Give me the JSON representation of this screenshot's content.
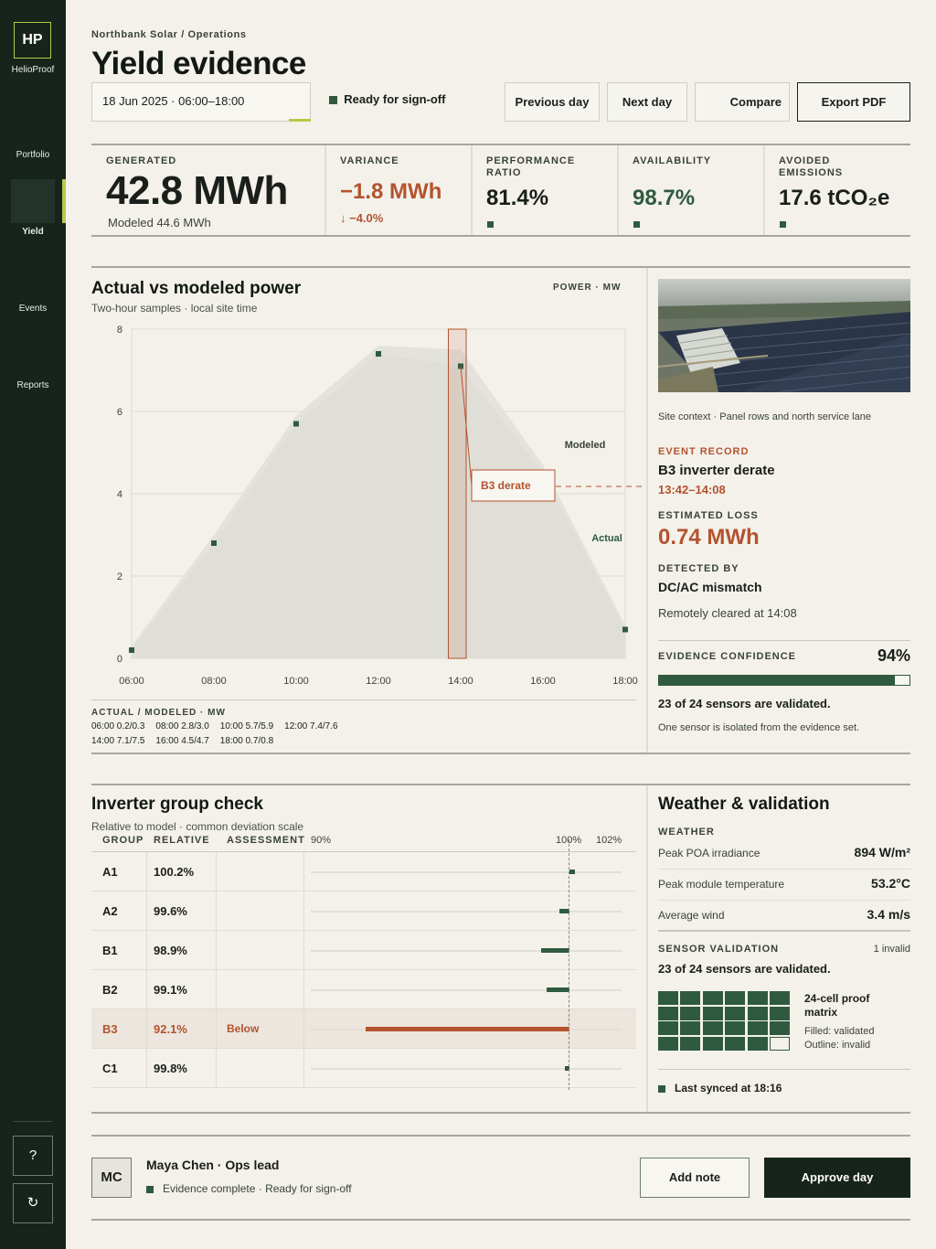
{
  "app": {
    "logo": "HP",
    "brand": "HelioProof"
  },
  "nav": {
    "portfolio": "Portfolio",
    "yield": "Yield",
    "events": "Events",
    "reports": "Reports",
    "help": "?",
    "refresh": "↻"
  },
  "header": {
    "breadcrumb": "Northbank Solar / Operations",
    "title": "Yield evidence",
    "date_range": "18 Jun 2025 · 06:00–18:00",
    "status": "Ready for sign-off",
    "prev": "Previous day",
    "next": "Next day",
    "compare": "Compare",
    "export": "Export PDF"
  },
  "kpis": {
    "generated": {
      "label": "GENERATED",
      "value": "42.8 MWh",
      "sub": "Modeled 44.6 MWh"
    },
    "variance": {
      "label": "VARIANCE",
      "value": "−1.8 MWh",
      "sub": "↓ −4.0%"
    },
    "pr": {
      "label1": "PERFORMANCE",
      "label2": "RATIO",
      "value": "81.4%"
    },
    "availability": {
      "label": "AVAILABILITY",
      "value": "98.7%"
    },
    "emissions": {
      "label1": "AVOIDED",
      "label2": "EMISSIONS",
      "value": "17.6 tCO₂e"
    }
  },
  "power": {
    "title": "Actual vs modeled power",
    "subtitle": "Two-hour samples · local site time",
    "unit": "POWER · MW",
    "modeled_label": "Modeled",
    "actual_label": "Actual",
    "event_label": "B3 derate",
    "samples_title": "ACTUAL / MODELED · MW",
    "samples": [
      "06:00  0.2/0.3",
      "08:00  2.8/3.0",
      "10:00  5.7/5.9",
      "12:00  7.4/7.6",
      "14:00  7.1/7.5",
      "16:00  4.5/4.7",
      "18:00  0.7/0.8"
    ]
  },
  "chart_data": {
    "type": "area",
    "title": "Actual vs modeled power",
    "ylabel": "POWER · MW",
    "x": [
      "06:00",
      "08:00",
      "10:00",
      "12:00",
      "14:00",
      "16:00",
      "18:00"
    ],
    "ylim": [
      0,
      8
    ],
    "yticks": [
      0,
      2,
      4,
      6,
      8
    ],
    "series": [
      {
        "name": "Actual",
        "values": [
          0.2,
          2.8,
          5.7,
          7.4,
          7.1,
          4.5,
          0.7
        ]
      },
      {
        "name": "Modeled",
        "values": [
          0.3,
          3.0,
          5.9,
          7.6,
          7.5,
          4.7,
          0.8
        ]
      }
    ],
    "event_band": {
      "label": "B3 derate",
      "from": "13:42",
      "to": "14:08"
    }
  },
  "site": {
    "caption": "Site context · Panel rows and north service lane",
    "event_label": "EVENT RECORD",
    "event_title": "B3 inverter derate",
    "event_time": "13:42–14:08",
    "loss_label": "ESTIMATED LOSS",
    "loss_value": "0.74 MWh",
    "detected_label": "DETECTED BY",
    "detected_value": "DC/AC mismatch",
    "cleared": "Remotely cleared at 14:08",
    "confidence_label": "EVIDENCE CONFIDENCE",
    "confidence_value": "94%",
    "confidence_fraction": 0.94,
    "sensors": "23 of 24 sensors are validated.",
    "sensors_note": "One sensor is isolated from the evidence set."
  },
  "inverters": {
    "title": "Inverter group check",
    "subtitle": "Relative to model · common deviation scale",
    "headers": {
      "group": "GROUP",
      "relative": "RELATIVE",
      "assessment": "ASSESSMENT",
      "t90": "90%",
      "t100": "100%",
      "t102": "102%"
    },
    "rows": [
      {
        "group": "A1",
        "relative": "100.2%",
        "assessment": "",
        "value": 100.2
      },
      {
        "group": "A2",
        "relative": "99.6%",
        "assessment": "",
        "value": 99.6
      },
      {
        "group": "B1",
        "relative": "98.9%",
        "assessment": "",
        "value": 98.9
      },
      {
        "group": "B2",
        "relative": "99.1%",
        "assessment": "",
        "value": 99.1
      },
      {
        "group": "B3",
        "relative": "92.1%",
        "assessment": "Below",
        "value": 92.1
      },
      {
        "group": "C1",
        "relative": "99.8%",
        "assessment": "",
        "value": 99.8
      }
    ]
  },
  "weather": {
    "title": "Weather & validation",
    "weather_label": "WEATHER",
    "rows": [
      {
        "label": "Peak POA irradiance",
        "value": "894 W/m²"
      },
      {
        "label": "Peak module temperature",
        "value": "53.2°C"
      },
      {
        "label": "Average wind",
        "value": "3.4 m/s"
      }
    ],
    "sensor_label": "SENSOR VALIDATION",
    "invalid_count": "1 invalid",
    "sensors": "23 of 24 sensors are validated.",
    "matrix_title1": "24-cell proof",
    "matrix_title2": "matrix",
    "legend_filled": "Filled: validated",
    "legend_outline": "Outline: invalid",
    "synced": "Last synced at 18:16"
  },
  "footer": {
    "initials": "MC",
    "name": "Maya Chen · Ops lead",
    "status": "Evidence complete · Ready for sign-off",
    "add_note": "Add note",
    "approve": "Approve day"
  },
  "colors": {
    "accent": "#b8c94a",
    "dark": "#16241c",
    "green": "#2f5a40",
    "alert": "#b4532f"
  }
}
